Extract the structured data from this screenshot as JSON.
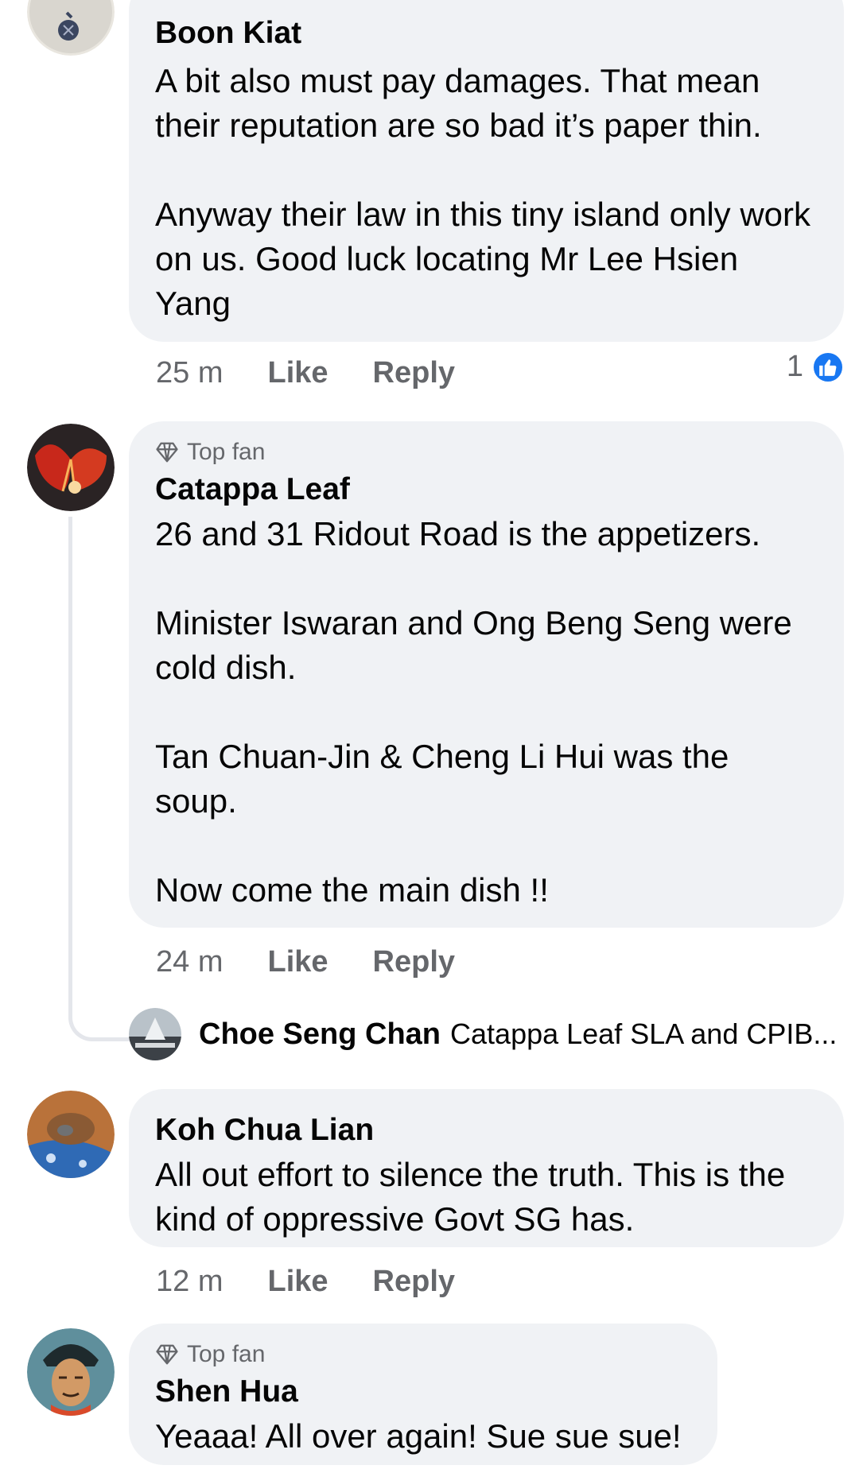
{
  "comments": [
    {
      "author": "Boon Kiat",
      "text": "A bit also must pay damages. That mean their reputation are so bad it’s paper thin.\n\nAnyway their law in this tiny island only work on us. Good luck locating Mr Lee Hsien Yang",
      "time": "25 m",
      "like_label": "Like",
      "reply_label": "Reply",
      "reaction_count": "1",
      "reaction_icon": "like-icon"
    },
    {
      "badge": "Top fan",
      "author": "Catappa Leaf",
      "text": "26 and 31 Ridout Road is the appetizers.\n\nMinister Iswaran and Ong Beng Seng were cold dish.\n\nTan Chuan-Jin & Cheng Li Hui was the soup.\n\nNow come the main dish !!",
      "time": "24 m",
      "like_label": "Like",
      "reply_label": "Reply",
      "reply_preview": {
        "author": "Choe Seng Chan",
        "text": "Catappa Leaf SLA and CPIB..."
      }
    },
    {
      "author": "Koh Chua Lian",
      "text": "All out effort to silence the truth. This is the kind of oppressive Govt SG has.",
      "time": "12 m",
      "like_label": "Like",
      "reply_label": "Reply"
    },
    {
      "badge": "Top fan",
      "author": "Shen Hua",
      "text": "Yeaaa! All over again! Sue sue sue!"
    }
  ],
  "colors": {
    "bubble": "#f0f2f5",
    "secondary_text": "#65676b",
    "like_blue": "#1877f2"
  }
}
